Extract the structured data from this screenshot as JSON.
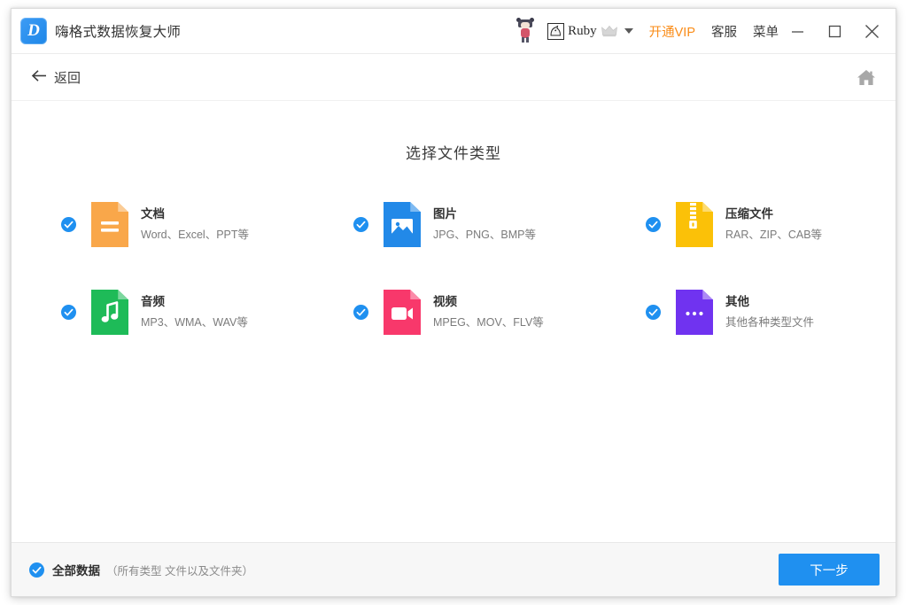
{
  "window": {
    "app_title": "嗨格式数据恢复大师",
    "logo_glyph": "D",
    "mascot_icon": "mascot-figure-icon",
    "accent_blue": "#1f90f0",
    "vip_orange": "#fa8c18"
  },
  "titlebar": {
    "avatar_icon": "user-avatar-icon",
    "user_name": "Ruby",
    "crown_icon": "crown-icon",
    "dropdown_icon": "chevron-down-icon",
    "vip_label": "开通VIP",
    "support_label": "客服",
    "menu_label": "菜单",
    "minimize_icon": "minimize-icon",
    "maximize_icon": "maximize-icon",
    "close_icon": "close-icon"
  },
  "subheader": {
    "back_icon": "arrow-left-icon",
    "back_label": "返回",
    "home_icon": "home-icon"
  },
  "main": {
    "page_title": "选择文件类型",
    "file_types": [
      {
        "name": "文档",
        "desc": "Word、Excel、PPT等",
        "icon": "document-file-icon",
        "color": "#F9A74A",
        "checked": true
      },
      {
        "name": "图片",
        "desc": "JPG、PNG、BMP等",
        "icon": "image-file-icon",
        "color": "#2289E8",
        "checked": true
      },
      {
        "name": "压缩文件",
        "desc": "RAR、ZIP、CAB等",
        "icon": "archive-file-icon",
        "color": "#FBC108",
        "checked": true
      },
      {
        "name": "音频",
        "desc": "MP3、WMA、WAV等",
        "icon": "audio-file-icon",
        "color": "#1EBB58",
        "checked": true
      },
      {
        "name": "视频",
        "desc": "MPEG、MOV、FLV等",
        "icon": "video-file-icon",
        "color": "#F8386B",
        "checked": true
      },
      {
        "name": "其他",
        "desc": "其他各种类型文件",
        "icon": "other-file-icon",
        "color": "#7033F0",
        "checked": true
      }
    ]
  },
  "footer": {
    "all_data_checked": true,
    "all_data_label": "全部数据",
    "all_data_note": "（所有类型 文件以及文件夹）",
    "next_label": "下一步"
  }
}
